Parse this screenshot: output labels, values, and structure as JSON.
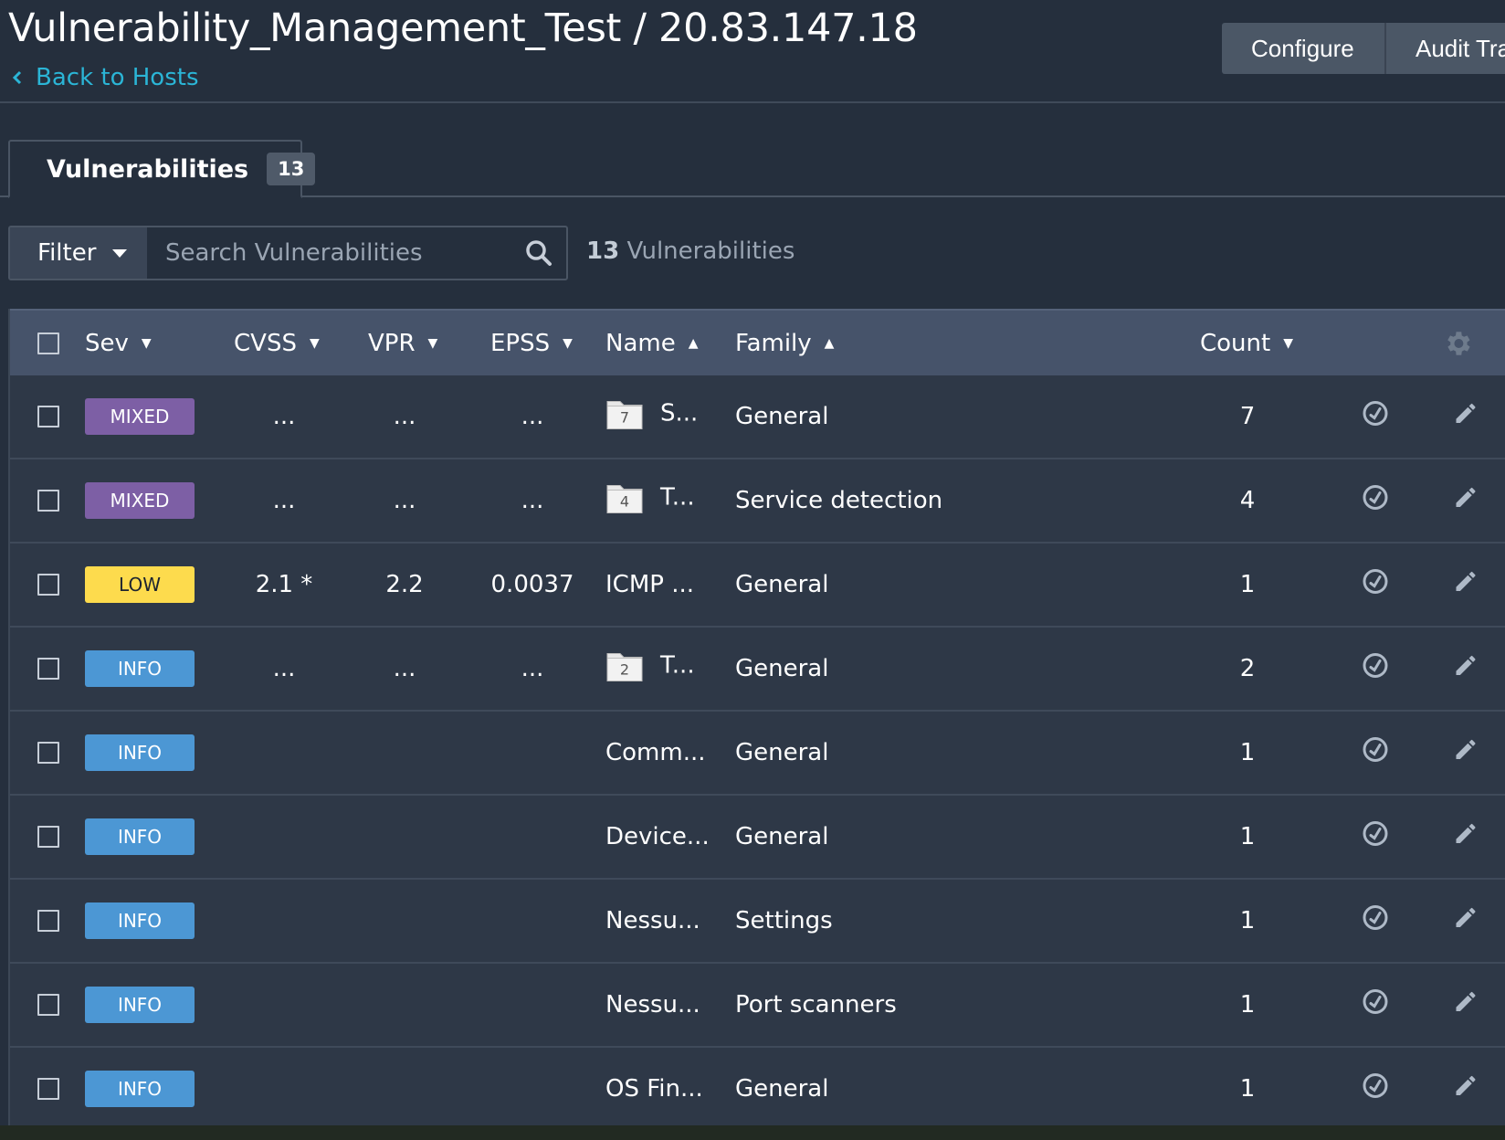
{
  "header": {
    "title": "Vulnerability_Management_Test / 20.83.147.18",
    "back_link": "Back to Hosts",
    "buttons": [
      "Configure",
      "Audit Trail"
    ]
  },
  "tab": {
    "label": "Vulnerabilities",
    "count": "13"
  },
  "filter": {
    "label": "Filter",
    "search_placeholder": "Search Vulnerabilities",
    "summary_count": "13",
    "summary_label": "Vulnerabilities"
  },
  "table": {
    "columns": [
      "Sev",
      "CVSS",
      "VPR",
      "EPSS",
      "Name",
      "Family",
      "Count"
    ],
    "rows": [
      {
        "sev": "MIXED",
        "sev_class": "sev-mixed",
        "cvss": "...",
        "vpr": "...",
        "epss": "...",
        "folder": "7",
        "name": "S...",
        "family": "General",
        "count": "7"
      },
      {
        "sev": "MIXED",
        "sev_class": "sev-mixed",
        "cvss": "...",
        "vpr": "...",
        "epss": "...",
        "folder": "4",
        "name": "T...",
        "family": "Service detection",
        "count": "4"
      },
      {
        "sev": "LOW",
        "sev_class": "sev-low",
        "cvss": "2.1 *",
        "vpr": "2.2",
        "epss": "0.0037",
        "folder": "",
        "name": "ICMP ...",
        "family": "General",
        "count": "1"
      },
      {
        "sev": "INFO",
        "sev_class": "sev-info",
        "cvss": "...",
        "vpr": "...",
        "epss": "...",
        "folder": "2",
        "name": "T...",
        "family": "General",
        "count": "2"
      },
      {
        "sev": "INFO",
        "sev_class": "sev-info",
        "cvss": "",
        "vpr": "",
        "epss": "",
        "folder": "",
        "name": "Comm...",
        "family": "General",
        "count": "1"
      },
      {
        "sev": "INFO",
        "sev_class": "sev-info",
        "cvss": "",
        "vpr": "",
        "epss": "",
        "folder": "",
        "name": "Device...",
        "family": "General",
        "count": "1"
      },
      {
        "sev": "INFO",
        "sev_class": "sev-info",
        "cvss": "",
        "vpr": "",
        "epss": "",
        "folder": "",
        "name": "Nessu...",
        "family": "Settings",
        "count": "1"
      },
      {
        "sev": "INFO",
        "sev_class": "sev-info",
        "cvss": "",
        "vpr": "",
        "epss": "",
        "folder": "",
        "name": "Nessu...",
        "family": "Port scanners",
        "count": "1"
      },
      {
        "sev": "INFO",
        "sev_class": "sev-info",
        "cvss": "",
        "vpr": "",
        "epss": "",
        "folder": "",
        "name": "OS Fin...",
        "family": "General",
        "count": "1"
      }
    ]
  },
  "colors": {
    "accent_link": "#2bb5d6",
    "mixed": "#7d5fa5",
    "low": "#fddb4d",
    "info": "#4c97d4"
  }
}
